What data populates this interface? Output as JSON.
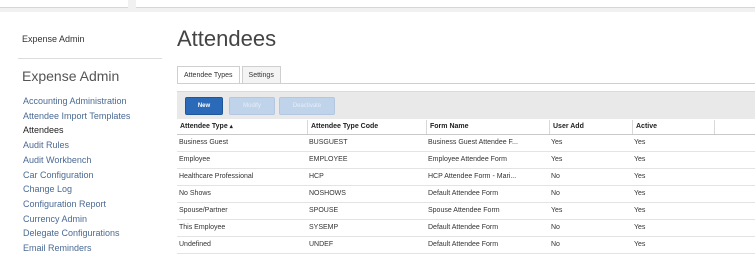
{
  "sidebar": {
    "header": "Expense Admin",
    "title": "Expense Admin",
    "items": [
      {
        "label": "Accounting Administration"
      },
      {
        "label": "Attendee Import Templates"
      },
      {
        "label": "Attendees",
        "active": true
      },
      {
        "label": "Audit Rules"
      },
      {
        "label": "Audit Workbench"
      },
      {
        "label": "Car Configuration"
      },
      {
        "label": "Change Log"
      },
      {
        "label": "Configuration Report"
      },
      {
        "label": "Currency Admin"
      },
      {
        "label": "Delegate Configurations"
      },
      {
        "label": "Email Reminders"
      }
    ]
  },
  "page": {
    "title": "Attendees"
  },
  "tabs": [
    {
      "label": "Attendee Types",
      "active": true
    },
    {
      "label": "Settings",
      "active": false
    }
  ],
  "toolbar": {
    "new_label": "New",
    "modify_label": "Modify",
    "deactivate_label": "Deactivate"
  },
  "table": {
    "columns": [
      "Attendee Type",
      "Attendee Type Code",
      "Form Name",
      "User Add",
      "Active",
      ""
    ],
    "sort_icon": "sort-ascending-icon",
    "rows": [
      [
        "Business Guest",
        "BUSGUEST",
        "Business Guest Attendee F...",
        "Yes",
        "Yes"
      ],
      [
        "Employee",
        "EMPLOYEE",
        "Employee Attendee Form",
        "Yes",
        "Yes"
      ],
      [
        "Healthcare Professional",
        "HCP",
        "HCP Attendee Form - Mari...",
        "No",
        "Yes"
      ],
      [
        "No Shows",
        "NOSHOWS",
        "Default Attendee Form",
        "No",
        "Yes"
      ],
      [
        "Spouse/Partner",
        "SPOUSE",
        "Spouse Attendee Form",
        "Yes",
        "Yes"
      ],
      [
        "This Employee",
        "SYSEMP",
        "Default Attendee Form",
        "No",
        "Yes"
      ],
      [
        "Undefined",
        "UNDEF",
        "Default Attendee Form",
        "No",
        "Yes"
      ]
    ]
  },
  "colors": {
    "primary_button": "#2a6ab8",
    "disabled_button": "#bfd3ea",
    "link": "#4a6a94",
    "toolbar_bg": "#e9e9e9"
  }
}
